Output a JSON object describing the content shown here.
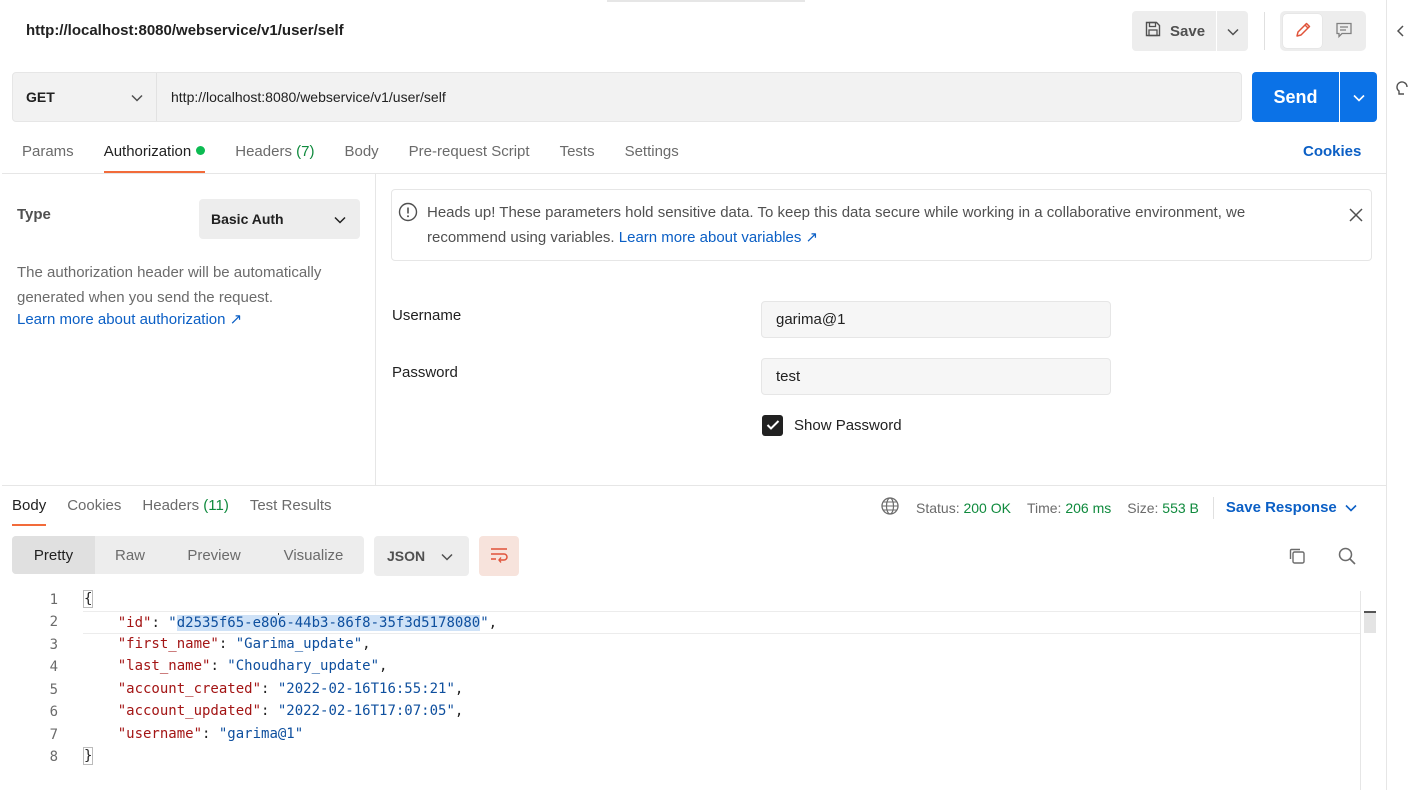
{
  "window": {
    "title": "http://localhost:8080/webservice/v1/user/self",
    "save_label": "Save"
  },
  "request": {
    "method": "GET",
    "url": "http://localhost:8080/webservice/v1/user/self",
    "send_label": "Send"
  },
  "request_tabs": {
    "params": "Params",
    "authorization": "Authorization",
    "headers": "Headers",
    "headers_count": "(7)",
    "body": "Body",
    "prerequest": "Pre-request Script",
    "tests": "Tests",
    "settings": "Settings",
    "cookies": "Cookies"
  },
  "auth": {
    "type_label": "Type",
    "type_value": "Basic Auth",
    "description": "The authorization header will be automatically generated when you send the request.",
    "learn_more": "Learn more about authorization ↗",
    "notice_text": "Heads up! These parameters hold sensitive data. To keep this data secure while working in a collaborative environment, we recommend using variables.",
    "notice_link": "Learn more about variables ↗",
    "username_label": "Username",
    "username_value": "garima@1",
    "password_label": "Password",
    "password_value": "test",
    "show_password_label": "Show Password",
    "show_password_checked": true
  },
  "response_tabs": {
    "body": "Body",
    "cookies": "Cookies",
    "headers": "Headers",
    "headers_count": "(11)",
    "test_results": "Test Results"
  },
  "response_meta": {
    "status_label": "Status:",
    "status_value": "200 OK",
    "time_label": "Time:",
    "time_value": "206 ms",
    "size_label": "Size:",
    "size_value": "553 B",
    "save_response": "Save Response"
  },
  "response_view": {
    "pretty": "Pretty",
    "raw": "Raw",
    "preview": "Preview",
    "visualize": "Visualize",
    "format": "JSON"
  },
  "code": {
    "line_numbers": [
      "1",
      "2",
      "3",
      "4",
      "5",
      "6",
      "7",
      "8"
    ],
    "open_brace": "{",
    "close_brace": "}",
    "id_key": "\"id\"",
    "id_value_selected": "d2535f65-e80",
    "id_value_rest": "6-44b3-86f8-35f3d5178080",
    "first_name_key": "\"first_name\"",
    "first_name_value": "\"Garima_update\"",
    "last_name_key": "\"last_name\"",
    "last_name_value": "\"Choudhary_update\"",
    "account_created_key": "\"account_created\"",
    "account_created_value": "\"2022-02-16T16:55:21\"",
    "account_updated_key": "\"account_updated\"",
    "account_updated_value": "\"2022-02-16T17:07:05\"",
    "username_key": "\"username\"",
    "username_value": "\"garima@1\""
  },
  "colors": {
    "accent_orange": "#f26b3a",
    "send_blue": "#0b72e7",
    "link_blue": "#0b5fc5",
    "status_green": "#0f8a3d"
  }
}
